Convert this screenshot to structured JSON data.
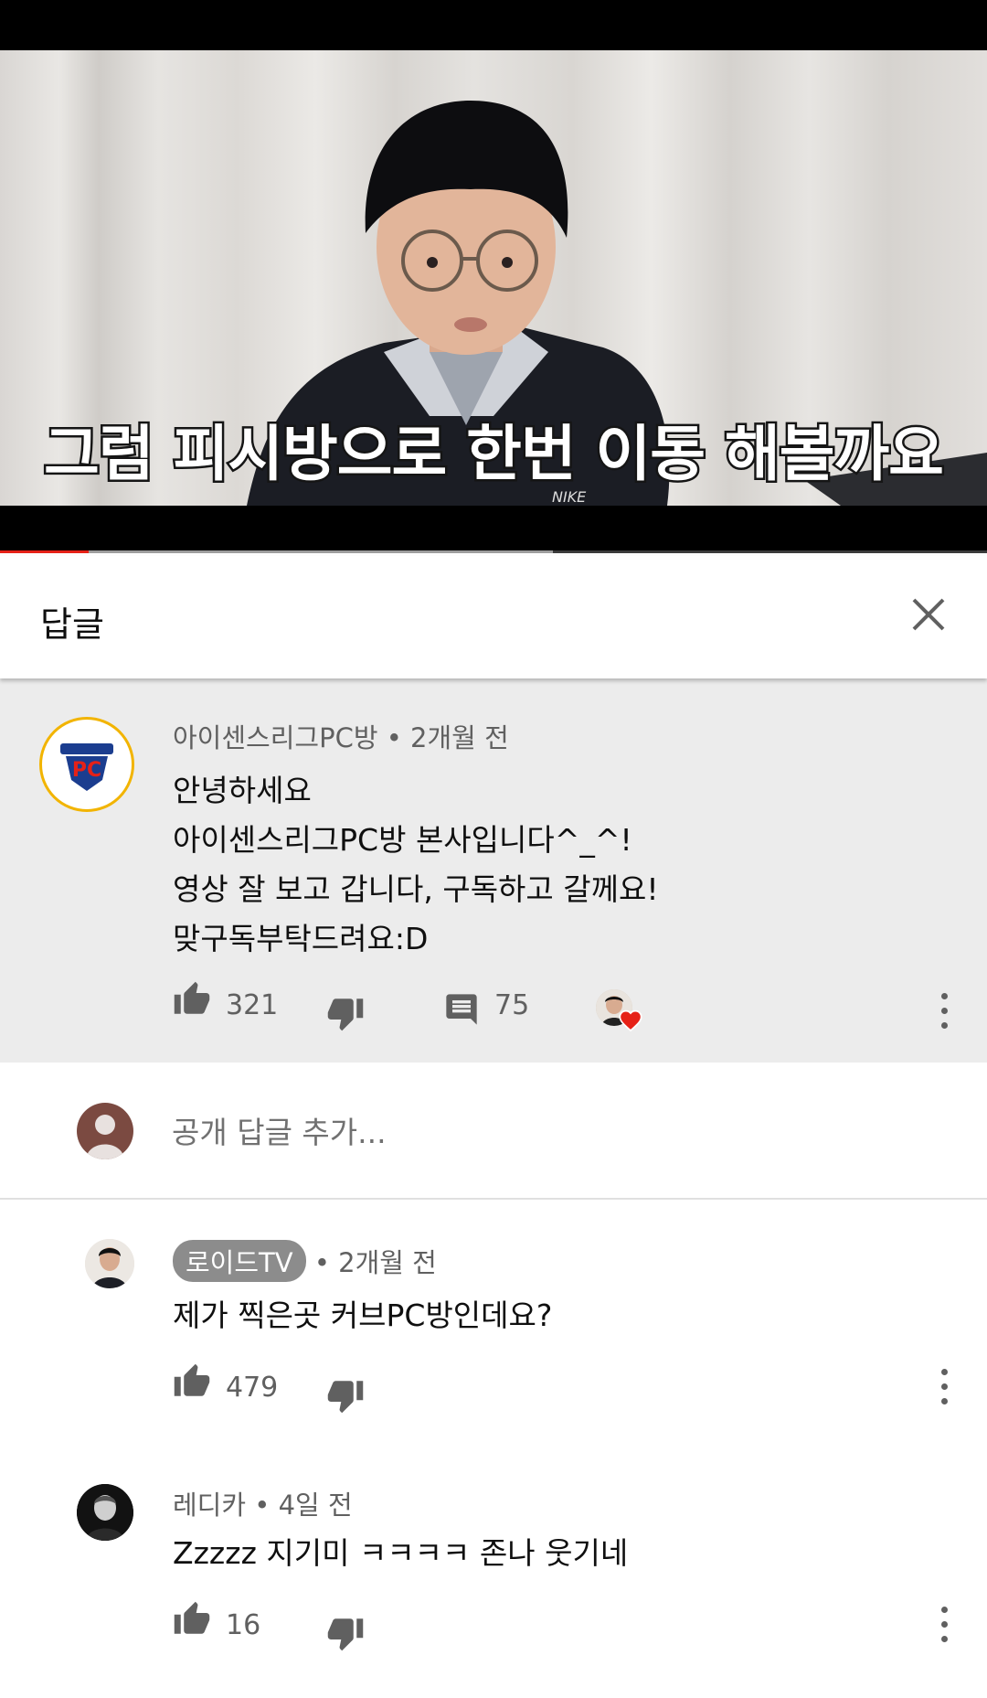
{
  "video": {
    "subtitle": "그럼 피시방으로 한번 이동 해볼까요",
    "played_fraction": 0.09,
    "buffered_fraction": 0.56
  },
  "panel": {
    "title": "답글",
    "close_icon": "close-icon"
  },
  "parent_comment": {
    "author": "아이센스리그PC방",
    "time": "2개월 전",
    "lines": [
      "안녕하세요",
      "아이센스리그PC방 본사입니다^_^!",
      "영상 잘 보고 갑니다, 구독하고 갈께요!",
      "맞구독부탁드려요:D"
    ],
    "likes": "321",
    "replies": "75",
    "avatar_text": "PC",
    "heart_color": "#e62117"
  },
  "reply_input": {
    "placeholder": "공개 답글 추가..."
  },
  "replies": [
    {
      "author": "로이드TV",
      "time": "2개월 전",
      "text": "제가 찍은곳 커브PC방인데요?",
      "likes": "479",
      "author_is_channel": true
    },
    {
      "author": "레디카",
      "time": "4일 전",
      "text": "Zzzzz 지기미 ㅋㅋㅋㅋ 존나 웃기네",
      "likes": "16",
      "author_is_channel": false
    }
  ],
  "colors": {
    "accent_red": "#e62117",
    "parent_bg": "#ececec",
    "meta_gray": "#606060"
  }
}
